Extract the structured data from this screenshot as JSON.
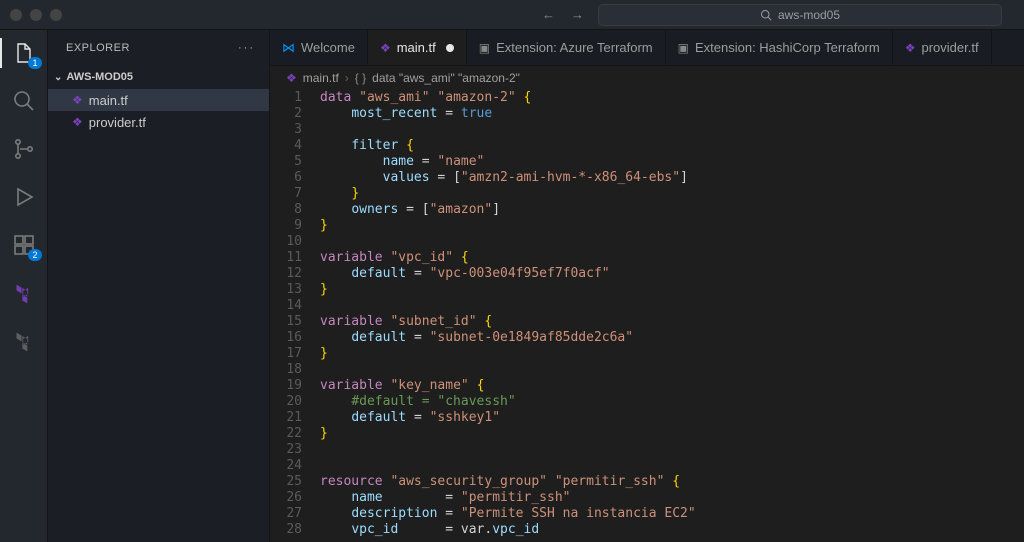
{
  "titlebar": {
    "search_text": "aws-mod05"
  },
  "activity": {
    "badge1": "1",
    "badge2": "2"
  },
  "sidebar": {
    "title": "EXPLORER",
    "folder": "AWS-MOD05",
    "files": [
      {
        "name": "main.tf"
      },
      {
        "name": "provider.tf"
      }
    ]
  },
  "tabs": [
    {
      "label": "Welcome",
      "kind": "welcome"
    },
    {
      "label": "main.tf",
      "kind": "tf",
      "active": true,
      "dirty": true
    },
    {
      "label": "Extension: Azure Terraform",
      "kind": "ext"
    },
    {
      "label": "Extension: HashiCorp Terraform",
      "kind": "ext"
    },
    {
      "label": "provider.tf",
      "kind": "tf"
    }
  ],
  "breadcrumb": {
    "file": "main.tf",
    "symbol": "data \"aws_ami\" \"amazon-2\""
  },
  "code_lines": [
    [
      {
        "t": "kw",
        "v": "data"
      },
      {
        "t": "p",
        "v": " "
      },
      {
        "t": "str",
        "v": "\"aws_ami\""
      },
      {
        "t": "p",
        "v": " "
      },
      {
        "t": "str",
        "v": "\"amazon-2\""
      },
      {
        "t": "p",
        "v": " "
      },
      {
        "t": "brace",
        "v": "{"
      }
    ],
    [
      {
        "t": "pad",
        "v": 1
      },
      {
        "t": "attr",
        "v": "most_recent"
      },
      {
        "t": "p",
        "v": " "
      },
      {
        "t": "eq",
        "v": "="
      },
      {
        "t": "p",
        "v": " "
      },
      {
        "t": "bool",
        "v": "true"
      }
    ],
    [],
    [
      {
        "t": "pad",
        "v": 1
      },
      {
        "t": "attr",
        "v": "filter"
      },
      {
        "t": "p",
        "v": " "
      },
      {
        "t": "brace",
        "v": "{"
      }
    ],
    [
      {
        "t": "pad",
        "v": 2
      },
      {
        "t": "attr",
        "v": "name"
      },
      {
        "t": "p",
        "v": " "
      },
      {
        "t": "eq",
        "v": "="
      },
      {
        "t": "p",
        "v": " "
      },
      {
        "t": "str",
        "v": "\"name\""
      }
    ],
    [
      {
        "t": "pad",
        "v": 2
      },
      {
        "t": "attr",
        "v": "values"
      },
      {
        "t": "p",
        "v": " "
      },
      {
        "t": "eq",
        "v": "="
      },
      {
        "t": "p",
        "v": " ["
      },
      {
        "t": "str",
        "v": "\"amzn2-ami-hvm-*-x86_64-ebs\""
      },
      {
        "t": "p",
        "v": "]"
      }
    ],
    [
      {
        "t": "pad",
        "v": 1
      },
      {
        "t": "brace",
        "v": "}"
      }
    ],
    [
      {
        "t": "pad",
        "v": 1
      },
      {
        "t": "attr",
        "v": "owners"
      },
      {
        "t": "p",
        "v": " "
      },
      {
        "t": "eq",
        "v": "="
      },
      {
        "t": "p",
        "v": " ["
      },
      {
        "t": "str",
        "v": "\"amazon\""
      },
      {
        "t": "p",
        "v": "]"
      }
    ],
    [
      {
        "t": "brace",
        "v": "}"
      }
    ],
    [],
    [
      {
        "t": "kw",
        "v": "variable"
      },
      {
        "t": "p",
        "v": " "
      },
      {
        "t": "str",
        "v": "\"vpc_id\""
      },
      {
        "t": "p",
        "v": " "
      },
      {
        "t": "brace",
        "v": "{"
      }
    ],
    [
      {
        "t": "pad",
        "v": 1
      },
      {
        "t": "attr",
        "v": "default"
      },
      {
        "t": "p",
        "v": " "
      },
      {
        "t": "eq",
        "v": "="
      },
      {
        "t": "p",
        "v": " "
      },
      {
        "t": "str",
        "v": "\"vpc-003e04f95ef7f0acf\""
      }
    ],
    [
      {
        "t": "brace",
        "v": "}"
      }
    ],
    [],
    [
      {
        "t": "kw",
        "v": "variable"
      },
      {
        "t": "p",
        "v": " "
      },
      {
        "t": "str",
        "v": "\"subnet_id\""
      },
      {
        "t": "p",
        "v": " "
      },
      {
        "t": "brace",
        "v": "{"
      }
    ],
    [
      {
        "t": "pad",
        "v": 1
      },
      {
        "t": "attr",
        "v": "default"
      },
      {
        "t": "p",
        "v": " "
      },
      {
        "t": "eq",
        "v": "="
      },
      {
        "t": "p",
        "v": " "
      },
      {
        "t": "str",
        "v": "\"subnet-0e1849af85dde2c6a\""
      }
    ],
    [
      {
        "t": "brace",
        "v": "}"
      }
    ],
    [],
    [
      {
        "t": "kw",
        "v": "variable"
      },
      {
        "t": "p",
        "v": " "
      },
      {
        "t": "str",
        "v": "\"key_name\""
      },
      {
        "t": "p",
        "v": " "
      },
      {
        "t": "brace",
        "v": "{"
      }
    ],
    [
      {
        "t": "pad",
        "v": 1
      },
      {
        "t": "cmnt",
        "v": "#default = \"chavessh\""
      }
    ],
    [
      {
        "t": "pad",
        "v": 1
      },
      {
        "t": "attr",
        "v": "default"
      },
      {
        "t": "p",
        "v": " "
      },
      {
        "t": "eq",
        "v": "="
      },
      {
        "t": "p",
        "v": " "
      },
      {
        "t": "str",
        "v": "\"sshkey1\""
      }
    ],
    [
      {
        "t": "brace",
        "v": "}"
      }
    ],
    [],
    [],
    [
      {
        "t": "kw",
        "v": "resource"
      },
      {
        "t": "p",
        "v": " "
      },
      {
        "t": "str",
        "v": "\"aws_security_group\""
      },
      {
        "t": "p",
        "v": " "
      },
      {
        "t": "str",
        "v": "\"permitir_ssh\""
      },
      {
        "t": "p",
        "v": " "
      },
      {
        "t": "brace",
        "v": "{"
      }
    ],
    [
      {
        "t": "pad",
        "v": 1
      },
      {
        "t": "attr",
        "v": "name"
      },
      {
        "t": "p",
        "v": "        "
      },
      {
        "t": "eq",
        "v": "="
      },
      {
        "t": "p",
        "v": " "
      },
      {
        "t": "str",
        "v": "\"permitir_ssh\""
      }
    ],
    [
      {
        "t": "pad",
        "v": 1
      },
      {
        "t": "attr",
        "v": "description"
      },
      {
        "t": "p",
        "v": " "
      },
      {
        "t": "eq",
        "v": "="
      },
      {
        "t": "p",
        "v": " "
      },
      {
        "t": "str",
        "v": "\"Permite SSH na instancia EC2\""
      }
    ],
    [
      {
        "t": "pad",
        "v": 1
      },
      {
        "t": "attr",
        "v": "vpc_id"
      },
      {
        "t": "p",
        "v": "      "
      },
      {
        "t": "eq",
        "v": "="
      },
      {
        "t": "p",
        "v": " var."
      },
      {
        "t": "attr",
        "v": "vpc_id"
      }
    ]
  ]
}
